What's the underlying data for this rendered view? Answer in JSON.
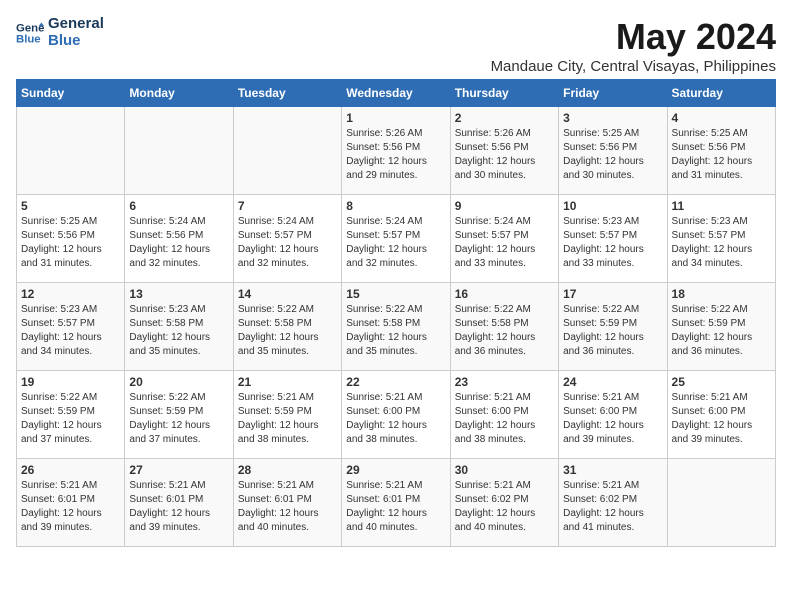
{
  "header": {
    "logo_line1": "General",
    "logo_line2": "Blue",
    "month": "May 2024",
    "location": "Mandaue City, Central Visayas, Philippines"
  },
  "weekdays": [
    "Sunday",
    "Monday",
    "Tuesday",
    "Wednesday",
    "Thursday",
    "Friday",
    "Saturday"
  ],
  "weeks": [
    [
      {
        "day": "",
        "info": ""
      },
      {
        "day": "",
        "info": ""
      },
      {
        "day": "",
        "info": ""
      },
      {
        "day": "1",
        "info": "Sunrise: 5:26 AM\nSunset: 5:56 PM\nDaylight: 12 hours\nand 29 minutes."
      },
      {
        "day": "2",
        "info": "Sunrise: 5:26 AM\nSunset: 5:56 PM\nDaylight: 12 hours\nand 30 minutes."
      },
      {
        "day": "3",
        "info": "Sunrise: 5:25 AM\nSunset: 5:56 PM\nDaylight: 12 hours\nand 30 minutes."
      },
      {
        "day": "4",
        "info": "Sunrise: 5:25 AM\nSunset: 5:56 PM\nDaylight: 12 hours\nand 31 minutes."
      }
    ],
    [
      {
        "day": "5",
        "info": "Sunrise: 5:25 AM\nSunset: 5:56 PM\nDaylight: 12 hours\nand 31 minutes."
      },
      {
        "day": "6",
        "info": "Sunrise: 5:24 AM\nSunset: 5:56 PM\nDaylight: 12 hours\nand 32 minutes."
      },
      {
        "day": "7",
        "info": "Sunrise: 5:24 AM\nSunset: 5:57 PM\nDaylight: 12 hours\nand 32 minutes."
      },
      {
        "day": "8",
        "info": "Sunrise: 5:24 AM\nSunset: 5:57 PM\nDaylight: 12 hours\nand 32 minutes."
      },
      {
        "day": "9",
        "info": "Sunrise: 5:24 AM\nSunset: 5:57 PM\nDaylight: 12 hours\nand 33 minutes."
      },
      {
        "day": "10",
        "info": "Sunrise: 5:23 AM\nSunset: 5:57 PM\nDaylight: 12 hours\nand 33 minutes."
      },
      {
        "day": "11",
        "info": "Sunrise: 5:23 AM\nSunset: 5:57 PM\nDaylight: 12 hours\nand 34 minutes."
      }
    ],
    [
      {
        "day": "12",
        "info": "Sunrise: 5:23 AM\nSunset: 5:57 PM\nDaylight: 12 hours\nand 34 minutes."
      },
      {
        "day": "13",
        "info": "Sunrise: 5:23 AM\nSunset: 5:58 PM\nDaylight: 12 hours\nand 35 minutes."
      },
      {
        "day": "14",
        "info": "Sunrise: 5:22 AM\nSunset: 5:58 PM\nDaylight: 12 hours\nand 35 minutes."
      },
      {
        "day": "15",
        "info": "Sunrise: 5:22 AM\nSunset: 5:58 PM\nDaylight: 12 hours\nand 35 minutes."
      },
      {
        "day": "16",
        "info": "Sunrise: 5:22 AM\nSunset: 5:58 PM\nDaylight: 12 hours\nand 36 minutes."
      },
      {
        "day": "17",
        "info": "Sunrise: 5:22 AM\nSunset: 5:59 PM\nDaylight: 12 hours\nand 36 minutes."
      },
      {
        "day": "18",
        "info": "Sunrise: 5:22 AM\nSunset: 5:59 PM\nDaylight: 12 hours\nand 36 minutes."
      }
    ],
    [
      {
        "day": "19",
        "info": "Sunrise: 5:22 AM\nSunset: 5:59 PM\nDaylight: 12 hours\nand 37 minutes."
      },
      {
        "day": "20",
        "info": "Sunrise: 5:22 AM\nSunset: 5:59 PM\nDaylight: 12 hours\nand 37 minutes."
      },
      {
        "day": "21",
        "info": "Sunrise: 5:21 AM\nSunset: 5:59 PM\nDaylight: 12 hours\nand 38 minutes."
      },
      {
        "day": "22",
        "info": "Sunrise: 5:21 AM\nSunset: 6:00 PM\nDaylight: 12 hours\nand 38 minutes."
      },
      {
        "day": "23",
        "info": "Sunrise: 5:21 AM\nSunset: 6:00 PM\nDaylight: 12 hours\nand 38 minutes."
      },
      {
        "day": "24",
        "info": "Sunrise: 5:21 AM\nSunset: 6:00 PM\nDaylight: 12 hours\nand 39 minutes."
      },
      {
        "day": "25",
        "info": "Sunrise: 5:21 AM\nSunset: 6:00 PM\nDaylight: 12 hours\nand 39 minutes."
      }
    ],
    [
      {
        "day": "26",
        "info": "Sunrise: 5:21 AM\nSunset: 6:01 PM\nDaylight: 12 hours\nand 39 minutes."
      },
      {
        "day": "27",
        "info": "Sunrise: 5:21 AM\nSunset: 6:01 PM\nDaylight: 12 hours\nand 39 minutes."
      },
      {
        "day": "28",
        "info": "Sunrise: 5:21 AM\nSunset: 6:01 PM\nDaylight: 12 hours\nand 40 minutes."
      },
      {
        "day": "29",
        "info": "Sunrise: 5:21 AM\nSunset: 6:01 PM\nDaylight: 12 hours\nand 40 minutes."
      },
      {
        "day": "30",
        "info": "Sunrise: 5:21 AM\nSunset: 6:02 PM\nDaylight: 12 hours\nand 40 minutes."
      },
      {
        "day": "31",
        "info": "Sunrise: 5:21 AM\nSunset: 6:02 PM\nDaylight: 12 hours\nand 41 minutes."
      },
      {
        "day": "",
        "info": ""
      }
    ]
  ]
}
